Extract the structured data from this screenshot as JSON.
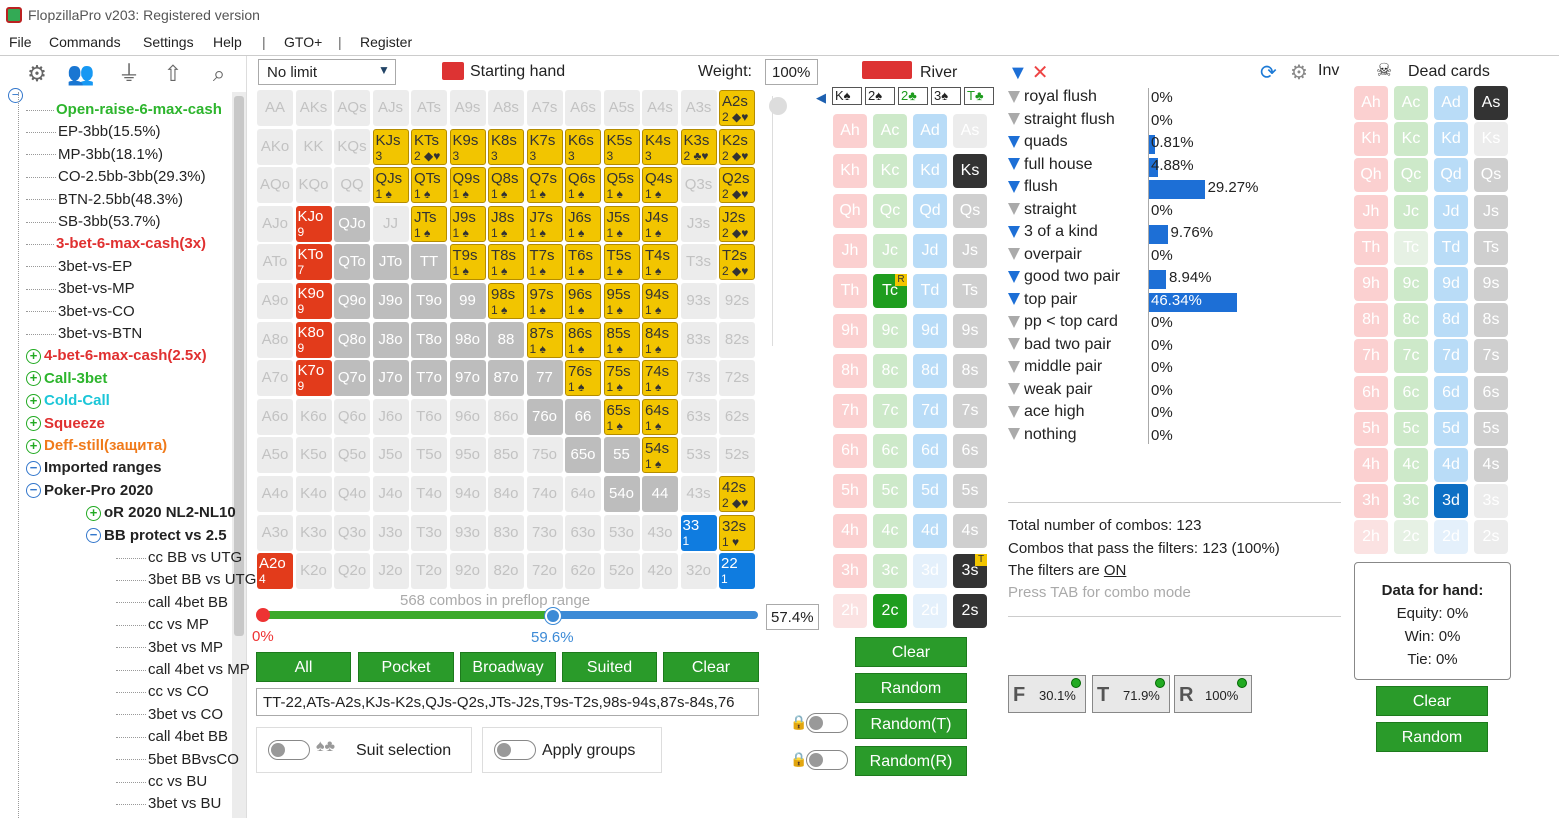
{
  "window": {
    "title": "FlopzillaPro v203: Registered version"
  },
  "menu": [
    "File",
    "Commands",
    "Settings",
    "Help",
    "|",
    "GTO+",
    "|",
    "Register"
  ],
  "tree": {
    "nodes": [
      {
        "label": "Open-raise-6-max-cash",
        "color": "#2db52d",
        "bold": true
      },
      {
        "label": "EP-3bb(15.5%)",
        "color": "#222",
        "bold": false
      },
      {
        "label": "MP-3bb(18.1%)",
        "color": "#222",
        "bold": false
      },
      {
        "label": "CO-2.5bb-3bb(29.3%)",
        "color": "#222",
        "bold": false
      },
      {
        "label": "BTN-2.5bb(48.3%)",
        "color": "#222",
        "bold": false
      },
      {
        "label": "SB-3bb(53.7%)",
        "color": "#222",
        "bold": false
      },
      {
        "label": "3-bet-6-max-cash(3x)",
        "color": "#e03030",
        "bold": true
      },
      {
        "label": "3bet-vs-EP",
        "color": "#222",
        "bold": false
      },
      {
        "label": "3bet-vs-MP",
        "color": "#222",
        "bold": false
      },
      {
        "label": "3bet-vs-CO",
        "color": "#222",
        "bold": false
      },
      {
        "label": "3bet-vs-BTN",
        "color": "#222",
        "bold": false
      },
      {
        "label": "4-bet-6-max-cash(2.5x)",
        "color": "#e03030",
        "bold": true
      },
      {
        "label": "Call-3bet",
        "color": "#2db52d",
        "bold": true
      },
      {
        "label": "Cold-Call",
        "color": "#1cc6d8",
        "bold": true
      },
      {
        "label": "Squeeze",
        "color": "#e03030",
        "bold": true
      },
      {
        "label": "Deff-still(защита)",
        "color": "#f07a1a",
        "bold": true
      },
      {
        "label": "Imported ranges",
        "color": "#222",
        "bold": true
      },
      {
        "label": "Poker-Pro 2020",
        "color": "#222",
        "bold": true
      },
      {
        "label": "oR 2020 NL2-NL10",
        "color": "#222",
        "bold": true
      },
      {
        "label": "BB protect vs 2.5",
        "color": "#222",
        "bold": true
      },
      {
        "label": "cc BB vs UTG",
        "color": "#222",
        "bold": false
      },
      {
        "label": "3bet BB vs UTG",
        "color": "#222",
        "bold": false
      },
      {
        "label": "call 4bet BB",
        "color": "#222",
        "bold": false
      },
      {
        "label": "cc vs MP",
        "color": "#222",
        "bold": false
      },
      {
        "label": "3bet vs MP",
        "color": "#222",
        "bold": false
      },
      {
        "label": "call 4bet vs MP",
        "color": "#222",
        "bold": false
      },
      {
        "label": "cc vs CO",
        "color": "#222",
        "bold": false
      },
      {
        "label": "3bet vs CO",
        "color": "#222",
        "bold": false
      },
      {
        "label": "call 4bet BB",
        "color": "#222",
        "bold": false
      },
      {
        "label": "5bet BBvsCO",
        "color": "#222",
        "bold": false
      },
      {
        "label": "cc vs BU",
        "color": "#222",
        "bold": false
      },
      {
        "label": "3bet vs BU",
        "color": "#222",
        "bold": false
      }
    ]
  },
  "controls": {
    "game": "No limit",
    "starting_hand_label": "Starting hand",
    "weight_label": "Weight:",
    "weight_value": "100%",
    "combos_in_range": "568 combos in preflop range",
    "slider_min": "0%",
    "slider_max": "59.6%",
    "slider_value": "57.4%",
    "buttons": [
      "All",
      "Pocket",
      "Broadway",
      "Suited",
      "Clear"
    ],
    "range_text": "TT-22,ATs-A2s,KJs-K2s,QJs-Q2s,JTs-J2s,T9s-T2s,98s-94s,87s-84s,76",
    "suit_selection": "Suit selection",
    "apply_groups": "Apply groups"
  },
  "grid": [
    [
      "AA",
      "AKs",
      "AQs",
      "AJs",
      "ATs",
      "A9s",
      "A8s",
      "A7s",
      "A6s",
      "A5s",
      "A4s",
      "A3s",
      "A2s"
    ],
    [
      "AKo",
      "KK",
      "KQs",
      "KJs",
      "KTs",
      "K9s",
      "K8s",
      "K7s",
      "K6s",
      "K5s",
      "K4s",
      "K3s",
      "K2s"
    ],
    [
      "AQo",
      "KQo",
      "QQ",
      "QJs",
      "QTs",
      "Q9s",
      "Q8s",
      "Q7s",
      "Q6s",
      "Q5s",
      "Q4s",
      "Q3s",
      "Q2s"
    ],
    [
      "AJo",
      "KJo",
      "QJo",
      "JJ",
      "JTs",
      "J9s",
      "J8s",
      "J7s",
      "J6s",
      "J5s",
      "J4s",
      "J3s",
      "J2s"
    ],
    [
      "ATo",
      "KTo",
      "QTo",
      "JTo",
      "TT",
      "T9s",
      "T8s",
      "T7s",
      "T6s",
      "T5s",
      "T4s",
      "T3s",
      "T2s"
    ],
    [
      "A9o",
      "K9o",
      "Q9o",
      "J9o",
      "T9o",
      "99",
      "98s",
      "97s",
      "96s",
      "95s",
      "94s",
      "93s",
      "92s"
    ],
    [
      "A8o",
      "K8o",
      "Q8o",
      "J8o",
      "T8o",
      "98o",
      "88",
      "87s",
      "86s",
      "85s",
      "84s",
      "83s",
      "82s"
    ],
    [
      "A7o",
      "K7o",
      "Q7o",
      "J7o",
      "T7o",
      "97o",
      "87o",
      "77",
      "76s",
      "75s",
      "74s",
      "73s",
      "72s"
    ],
    [
      "A6o",
      "K6o",
      "Q6o",
      "J6o",
      "T6o",
      "96o",
      "86o",
      "76o",
      "66",
      "65s",
      "64s",
      "63s",
      "62s"
    ],
    [
      "A5o",
      "K5o",
      "Q5o",
      "J5o",
      "T5o",
      "95o",
      "85o",
      "75o",
      "65o",
      "55",
      "54s",
      "53s",
      "52s"
    ],
    [
      "A4o",
      "K4o",
      "Q4o",
      "J4o",
      "T4o",
      "94o",
      "84o",
      "74o",
      "64o",
      "54o",
      "44",
      "43s",
      "42s"
    ],
    [
      "A3o",
      "K3o",
      "Q3o",
      "J3o",
      "T3o",
      "93o",
      "83o",
      "73o",
      "63o",
      "53o",
      "43o",
      "33",
      "32s"
    ],
    [
      "A2o",
      "K2o",
      "Q2o",
      "J2o",
      "T2o",
      "92o",
      "82o",
      "72o",
      "62o",
      "52o",
      "42o",
      "32o",
      "22"
    ]
  ],
  "grid_states": [
    "EEEEEEEEEEEEY",
    "EEEYYYYYYYYYY",
    "EEEYYYYYYYYEY",
    "ERGEYYYYYYYEY",
    "ERGGGYYYYYYEY",
    "ERGGGGYYYYYEE",
    "ERGGGGGYYYYEE",
    "ERGGGGGGYYYEE",
    "EEEEEEEGGYYEE",
    "EEEEEEEEGGYEE",
    "EEEEEEEEEGGEY",
    "EEEEEEEEEEEBY",
    "REEEEEEEEEEEB"
  ],
  "grid_sub": {
    "0,12": "2 ◆♥",
    "1,3": "3",
    "1,4": "2 ◆♥",
    "1,5": "3",
    "1,6": "3",
    "1,7": "3",
    "1,8": "3",
    "1,9": "3",
    "1,10": "3",
    "1,11": "2 ♣♥",
    "1,12": "2 ◆♥",
    "2,3": "1 ♠",
    "2,4": "1 ♠",
    "2,5": "1 ♠",
    "2,6": "1 ♠",
    "2,7": "1 ♠",
    "2,8": "1 ♠",
    "2,9": "1 ♠",
    "2,10": "1 ♠",
    "2,12": "2 ◆♥",
    "3,1": "9",
    "3,4": "1 ♠",
    "3,5": "1 ♠",
    "3,6": "1 ♠",
    "3,7": "1 ♠",
    "3,8": "1 ♠",
    "3,9": "1 ♠",
    "3,10": "1 ♠",
    "3,12": "2 ◆♥",
    "4,1": "7",
    "4,5": "1 ♠",
    "4,6": "1 ♠",
    "4,7": "1 ♠",
    "4,8": "1 ♠",
    "4,9": "1 ♠",
    "4,10": "1 ♠",
    "4,12": "2 ◆♥",
    "5,1": "9",
    "5,6": "1 ♠",
    "5,7": "1 ♠",
    "5,8": "1 ♠",
    "5,9": "1 ♠",
    "5,10": "1 ♠",
    "6,1": "9",
    "6,7": "1 ♠",
    "6,8": "1 ♠",
    "6,9": "1 ♠",
    "6,10": "1 ♠",
    "7,1": "9",
    "7,8": "1 ♠",
    "7,9": "1 ♠",
    "7,10": "1 ♠",
    "8,9": "1 ♠",
    "8,10": "1 ♠",
    "9,10": "1 ♠",
    "10,12": "2 ◆♥",
    "11,11": "1",
    "11,12": "1 ♥",
    "12,0": "4",
    "12,12": "1"
  },
  "river": {
    "label": "River",
    "board": [
      "K♠",
      "2♠",
      "2♣",
      "3♠",
      "T♣"
    ],
    "ranks": [
      "A",
      "K",
      "Q",
      "J",
      "T",
      "9",
      "8",
      "7",
      "6",
      "5",
      "4",
      "3",
      "2"
    ],
    "selected": {
      "K,s": "dark",
      "T,c": "green",
      "3,s": "dark",
      "2,c": "green",
      "2,s": "dark"
    },
    "badges": {
      "T,c": "R",
      "3,s": "T"
    },
    "buttons": [
      "Clear",
      "Random",
      "Random(T)",
      "Random(R)"
    ]
  },
  "hands": {
    "inv_label": "Inv",
    "rows": [
      {
        "name": "royal flush",
        "pct": "0%",
        "value": 0,
        "active": false
      },
      {
        "name": "straight flush",
        "pct": "0%",
        "value": 0,
        "active": false
      },
      {
        "name": "quads",
        "pct": "0.81%",
        "value": 0.81,
        "active": true
      },
      {
        "name": "full house",
        "pct": "4.88%",
        "value": 4.88,
        "active": true
      },
      {
        "name": "flush",
        "pct": "29.27%",
        "value": 29.27,
        "active": true
      },
      {
        "name": "straight",
        "pct": "0%",
        "value": 0,
        "active": false
      },
      {
        "name": "3 of a kind",
        "pct": "9.76%",
        "value": 9.76,
        "active": true
      },
      {
        "name": "overpair",
        "pct": "0%",
        "value": 0,
        "active": false
      },
      {
        "name": "good two pair",
        "pct": "8.94%",
        "value": 8.94,
        "active": true
      },
      {
        "name": "top pair",
        "pct": "46.34%",
        "value": 46.34,
        "active": true
      },
      {
        "name": "pp < top card",
        "pct": "0%",
        "value": 0,
        "active": false
      },
      {
        "name": "bad two pair",
        "pct": "0%",
        "value": 0,
        "active": false
      },
      {
        "name": "middle pair",
        "pct": "0%",
        "value": 0,
        "active": false
      },
      {
        "name": "weak pair",
        "pct": "0%",
        "value": 0,
        "active": false
      },
      {
        "name": "ace high",
        "pct": "0%",
        "value": 0,
        "active": false
      },
      {
        "name": "nothing",
        "pct": "0%",
        "value": 0,
        "active": false
      }
    ],
    "total_combos": "Total number of combos: 123",
    "pass_combos": "Combos that pass the filters: 123 (100%)",
    "filters_are": "The filters are ",
    "filters_state": "ON",
    "tab_hint": "Press TAB for combo mode",
    "fboxes": [
      {
        "letter": "F",
        "value": "30.1%"
      },
      {
        "letter": "T",
        "value": "71.9%"
      },
      {
        "letter": "R",
        "value": "100%"
      }
    ]
  },
  "dead": {
    "label": "Dead cards",
    "selected": {
      "A,s": "dark",
      "3,d": "blue"
    },
    "data_title": "Data for hand:",
    "equity": "Equity: 0%",
    "win": "Win: 0%",
    "tie": "Tie: 0%",
    "buttons": [
      "Clear",
      "Random"
    ]
  },
  "colors": {
    "accent_green": "#2a9b2a",
    "bar_blue": "#1d6fd6",
    "yellow": "#f2c500"
  }
}
